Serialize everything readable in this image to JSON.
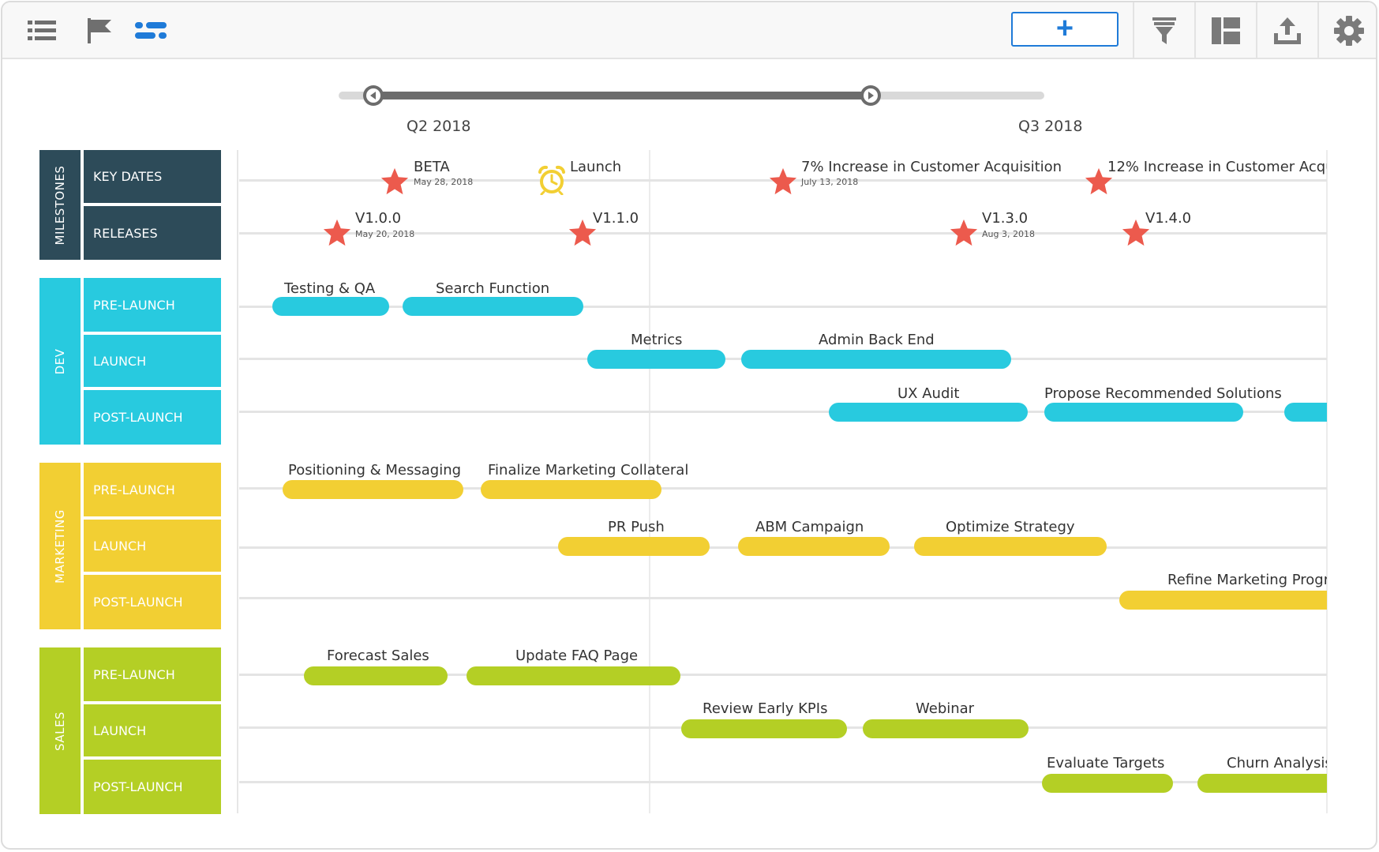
{
  "toolbar": {
    "left_icons": [
      "list-icon",
      "flag-icon",
      "timeline-icon"
    ],
    "add_label": "+",
    "right_icons": [
      "filter-icon",
      "layout-icon",
      "export-icon",
      "gear-icon"
    ]
  },
  "range": {
    "start_label": "Q2 2018",
    "end_label": "Q3 2018"
  },
  "colors": {
    "milestones": "#2d4b59",
    "dev": "#28cadf",
    "marketing": "#f2cf33",
    "sales": "#b4cf25",
    "star": "#ec5a4d",
    "alarm": "#f2cf33"
  },
  "groups": [
    {
      "label": "MILESTONES",
      "rows": [
        "KEY DATES",
        "RELEASES"
      ]
    },
    {
      "label": "DEV",
      "rows": [
        "PRE-LAUNCH",
        "LAUNCH",
        "POST-LAUNCH"
      ]
    },
    {
      "label": "MARKETING",
      "rows": [
        "PRE-LAUNCH",
        "LAUNCH",
        "POST-LAUNCH"
      ]
    },
    {
      "label": "SALES",
      "rows": [
        "PRE-LAUNCH",
        "LAUNCH",
        "POST-LAUNCH"
      ]
    }
  ],
  "milestones": {
    "key_dates": [
      {
        "name": "BETA",
        "date": "May 28, 2018",
        "icon": "star-icon"
      },
      {
        "name": "Launch",
        "date": "",
        "icon": "alarm-clock-icon"
      },
      {
        "name": "7% Increase in Customer Acquisition",
        "date": "July 13, 2018",
        "icon": "star-icon"
      },
      {
        "name": "12% Increase in Customer Acqu",
        "date": "",
        "icon": "star-icon"
      }
    ],
    "releases": [
      {
        "name": "V1.0.0",
        "date": "May 20, 2018",
        "icon": "star-icon"
      },
      {
        "name": "V1.1.0",
        "date": "",
        "icon": "star-icon"
      },
      {
        "name": "V1.3.0",
        "date": "Aug 3, 2018",
        "icon": "star-icon"
      },
      {
        "name": "V1.4.0",
        "date": "",
        "icon": "star-icon"
      }
    ]
  },
  "bars": {
    "dev_pre": [
      "Testing & QA",
      "Search Function"
    ],
    "dev_launch": [
      "Metrics",
      "Admin Back End"
    ],
    "dev_post": [
      "UX Audit",
      "Propose Recommended Solutions",
      ""
    ],
    "mkt_pre": [
      "Positioning & Messaging",
      "Finalize Marketing Collateral"
    ],
    "mkt_launch": [
      "PR Push",
      "ABM Campaign",
      "Optimize Strategy"
    ],
    "mkt_post": [
      "Refine Marketing Progr"
    ],
    "sales_pre": [
      "Forecast Sales",
      "Update FAQ Page"
    ],
    "sales_launch": [
      "Review Early KPIs",
      "Webinar"
    ],
    "sales_post": [
      "Evaluate Targets",
      "Churn Analysis"
    ]
  }
}
